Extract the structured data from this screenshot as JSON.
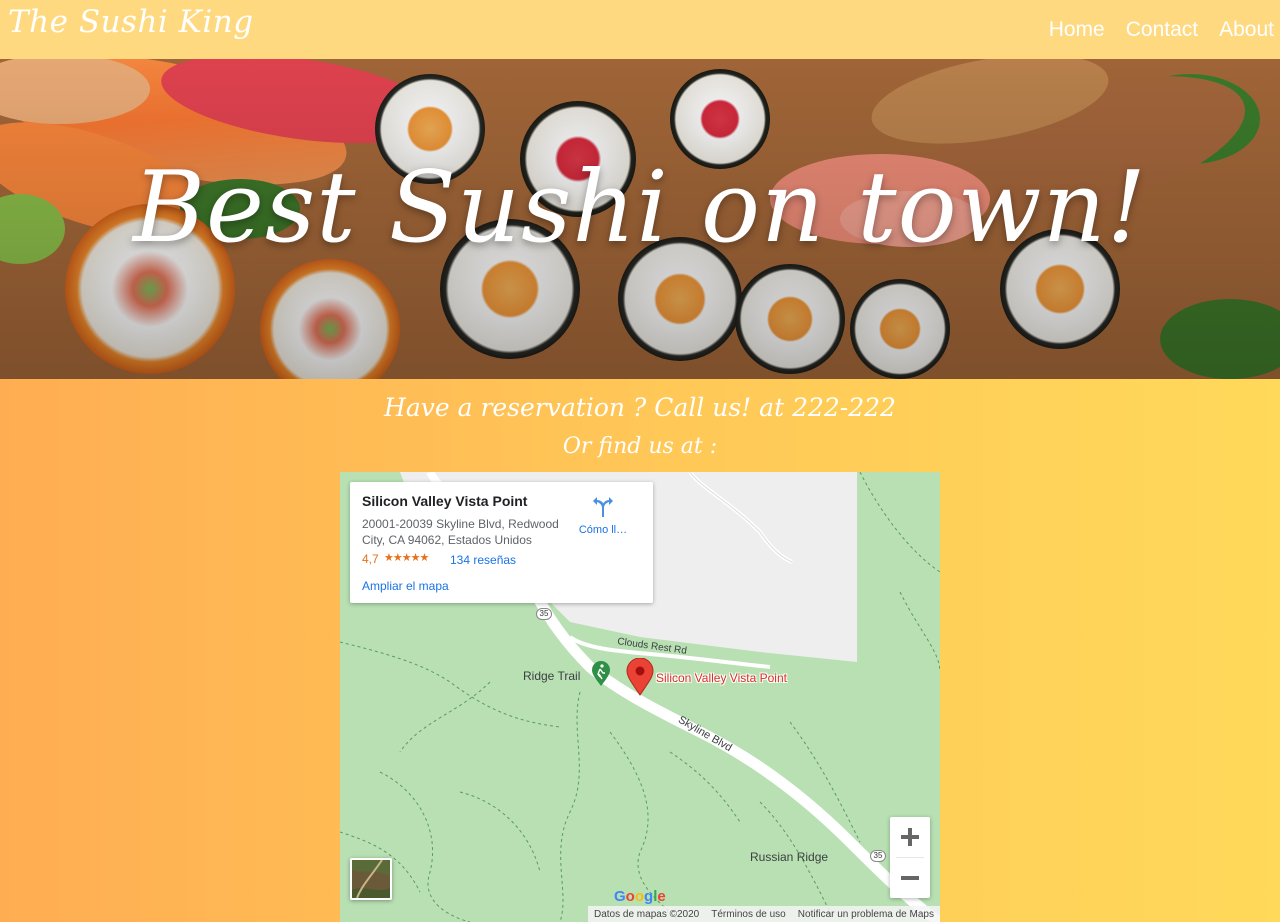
{
  "navbar": {
    "brand": "The Sushi King",
    "links": [
      "Home",
      "Contact",
      "About"
    ]
  },
  "hero": {
    "title": "Best Sushi on town!"
  },
  "contact": {
    "reservation": "Have a reservation ? Call us! at 222-222",
    "find_us": "Or find us at :"
  },
  "map": {
    "info": {
      "place_name": "Silicon Valley Vista Point",
      "address": "20001-20039 Skyline Blvd, Redwood City, CA 94062, Estados Unidos",
      "rating": "4,7",
      "stars": "★★★★★",
      "rating_value": 4.7,
      "reviews": "134 reseñas",
      "directions": "Cómo ll…",
      "enlarge": "Ampliar el mapa"
    },
    "labels": {
      "clouds_rest": "Clouds Rest Rd",
      "ridge_trail": "Ridge Trail",
      "vista_point": "Silicon Valley Vista Point",
      "skyline": "Skyline Blvd",
      "russian_ridge": "Russian Ridge",
      "route": "35"
    },
    "zoom_in": "+",
    "zoom_out": "−",
    "google": "Google",
    "attribution": [
      "Datos de mapas ©2020",
      "Términos de uso",
      "Notificar un problema de Maps"
    ],
    "icons": [
      "directions-icon",
      "map-pin-icon",
      "hiking-icon",
      "satellite-thumbnail"
    ]
  },
  "colors": {
    "navbar_bg": "#ffd97f",
    "page_gradient_left": "#ffad52",
    "page_gradient_right": "#ffd95a",
    "map_park": "#b8e0b3",
    "marker": "#ea4335",
    "link_blue": "#1a73e8"
  }
}
